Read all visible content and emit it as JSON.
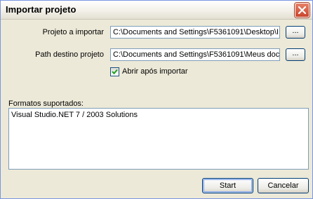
{
  "window": {
    "title": "Importar projeto",
    "close_symbol": "×"
  },
  "project_import": {
    "label": "Projeto a importar",
    "value": "C:\\Documents and Settings\\F5361091\\Desktop\\I",
    "browse_label": "..."
  },
  "destination": {
    "label": "Path destino projeto",
    "value": "C:\\Documents and Settings\\F5361091\\Meus doc",
    "browse_label": "..."
  },
  "open_after_import": {
    "label": "Abrir após importar",
    "checked": true
  },
  "formats": {
    "label": "Formatos suportados:",
    "items": [
      "Visual Studio.NET 7 / 2003 Solutions"
    ]
  },
  "buttons": {
    "start": "Start",
    "cancel": "Cancelar"
  },
  "colors": {
    "close_button": "#c8452c",
    "field_border": "#7f9db9",
    "dialog_bg": "#ece9d8"
  }
}
